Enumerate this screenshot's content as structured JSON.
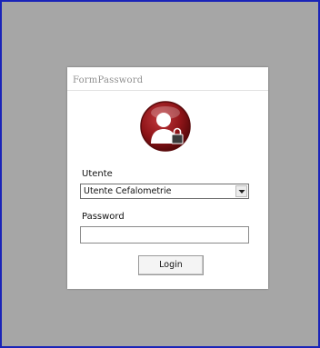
{
  "window": {
    "title": "FormPassword"
  },
  "form": {
    "user_label": "Utente",
    "user_select_value": "Utente Cefalometrie",
    "password_label": "Password",
    "password_value": "",
    "login_button": "Login"
  },
  "icons": {
    "avatar": "user-lock-icon",
    "dropdown": "chevron-down-icon"
  },
  "colors": {
    "desktop_border": "#1a24b8",
    "desktop_background": "#a6a6a6",
    "avatar_red": "#8e1418"
  }
}
